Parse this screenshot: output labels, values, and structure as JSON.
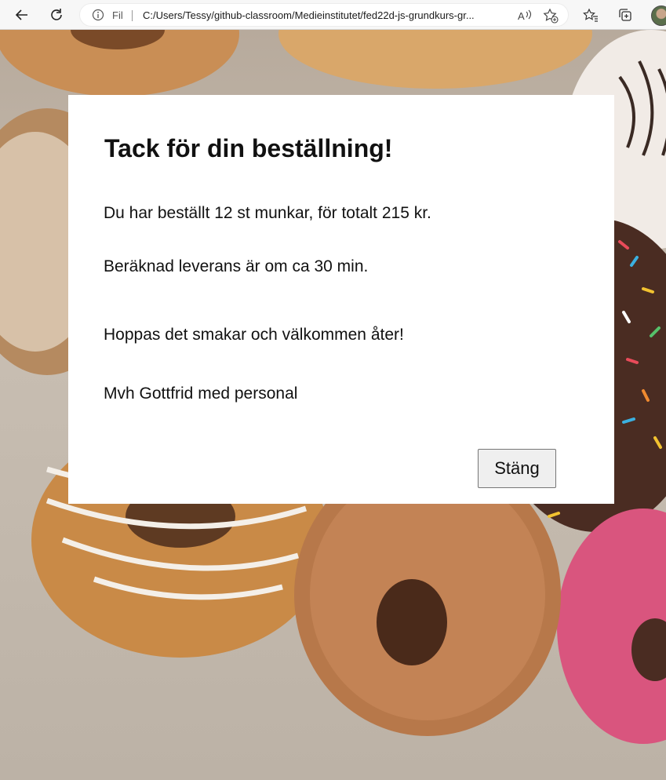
{
  "browser": {
    "site_info_label": "Fil",
    "url": "C:/Users/Tessy/github-classroom/Medieinstitutet/fed22d-js-grundkurs-gr..."
  },
  "modal": {
    "title": "Tack för din beställning!",
    "order_summary": "Du har beställt 12 st munkar, för totalt 215 kr.",
    "delivery_estimate": "Beräknad leverans är om ca 30 min.",
    "greeting": "Hoppas det smakar och välkommen åter!",
    "signature": "Mvh Gottfrid med personal",
    "close_label": "Stäng"
  }
}
